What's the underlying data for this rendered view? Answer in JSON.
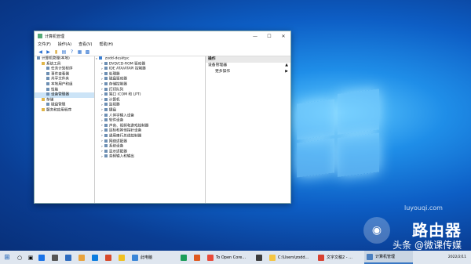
{
  "window": {
    "title": "计算机管理",
    "menu": [
      "文件(F)",
      "操作(A)",
      "查看(V)",
      "帮助(H)"
    ]
  },
  "left_tree": [
    {
      "label": "计算机管理(本地)",
      "indent": 0,
      "icon": "computer-management-icon"
    },
    {
      "label": "系统工具",
      "indent": 1,
      "icon": "tools-icon"
    },
    {
      "label": "任务计划程序",
      "indent": 2,
      "icon": "task-scheduler-icon"
    },
    {
      "label": "事件查看器",
      "indent": 2,
      "icon": "event-viewer-icon"
    },
    {
      "label": "共享文件夹",
      "indent": 2,
      "icon": "shared-folder-icon"
    },
    {
      "label": "本地用户和组",
      "indent": 2,
      "icon": "users-icon"
    },
    {
      "label": "性能",
      "indent": 2,
      "icon": "performance-icon"
    },
    {
      "label": "设备管理器",
      "indent": 2,
      "icon": "device-manager-icon",
      "selected": true
    },
    {
      "label": "存储",
      "indent": 1,
      "icon": "storage-icon"
    },
    {
      "label": "磁盘管理",
      "indent": 2,
      "icon": "disk-icon"
    },
    {
      "label": "服务和应用程序",
      "indent": 1,
      "icon": "services-icon"
    }
  ],
  "device_tree": {
    "root": "zodd-desktpc",
    "items": [
      "DVD/CD-ROM 驱动器",
      "IDE ATA/ATAPI 控制器",
      "处理器",
      "磁盘驱动器",
      "存储控制器",
      "打印队列",
      "端口 (COM 和 LPT)",
      "计算机",
      "监视器",
      "键盘",
      "人体学输入设备",
      "软件设备",
      "声音、视频和游戏控制器",
      "鼠标和其他指针设备",
      "通用串行总线控制器",
      "网络适配器",
      "系统设备",
      "显示适配器",
      "音频输入和输出"
    ]
  },
  "actions": {
    "header": "操作",
    "section": "设备管理器",
    "more": "更多操作"
  },
  "taskbar": {
    "items": [
      {
        "label": "",
        "color": "#1a73e8"
      },
      {
        "label": "",
        "color": "#555"
      },
      {
        "label": "",
        "color": "#2d6cc0"
      },
      {
        "label": "",
        "color": "#e8a33d"
      },
      {
        "label": "",
        "color": "#0b7de0"
      },
      {
        "label": "",
        "color": "#d84a2b"
      },
      {
        "label": "",
        "color": "#f0c020"
      },
      {
        "label": "此电脑",
        "color": "#3a86d8",
        "wide": true
      },
      {
        "label": "",
        "color": "#1c9e5a"
      },
      {
        "label": "",
        "color": "#e05a20"
      },
      {
        "label": "To Open Core...",
        "color": "#e84a3a",
        "wide": true
      },
      {
        "label": "",
        "color": "#3c3c3c"
      },
      {
        "label": "C:\\Users\\zodd...",
        "color": "#f4c542",
        "wide": true
      },
      {
        "label": "文字文稿2 - ...",
        "color": "#d84030",
        "wide": true
      },
      {
        "label": "计算机管理",
        "color": "#4a7fc0",
        "wide": true,
        "active": true
      }
    ],
    "clock": "2022/2/11"
  },
  "watermark": {
    "text": "路由器",
    "sub": "luyouqi.com",
    "brand": "头条 @微课传媒"
  }
}
